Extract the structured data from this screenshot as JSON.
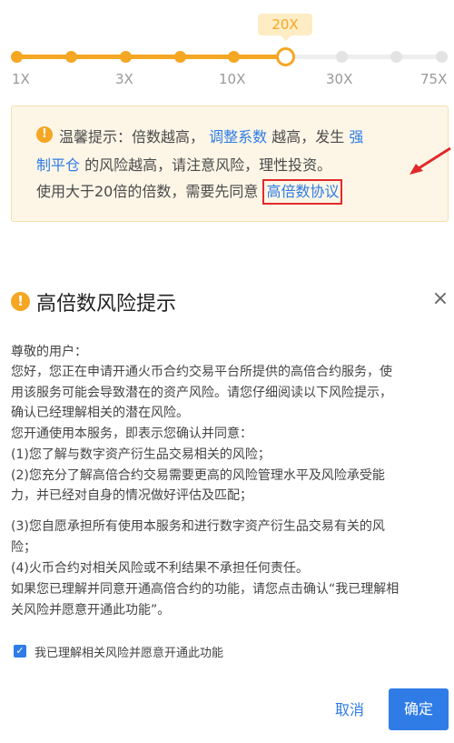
{
  "slider": {
    "current_value": "20X",
    "ticks": [
      "1X",
      "3X",
      "10X",
      "30X",
      "75X"
    ]
  },
  "notice": {
    "line1_a": "温馨提示：倍数越高，",
    "line1_link": "调整系数",
    "line1_b": "越高，发生",
    "line1_link2": "强",
    "line2_link": "制平仓",
    "line2_b": "的风险越高，请注意风险，理性投资。",
    "line3_a": "使用大于20倍的倍数，需要先同意",
    "line3_link": "高倍数协议"
  },
  "modal": {
    "title": "高倍数风险提示",
    "close_symbol": "×",
    "body_lines": [
      "尊敬的用户：",
      "您好，您正在申请开通火币合约交易平台所提供的高倍合约服务，使",
      "用该服务可能会导致潜在的资产风险。请您仔细阅读以下风险提示，",
      "确认已经理解相关的潜在风险。",
      "您开通使用本服务，即表示您确认并同意：",
      "(1)您了解与数字资产衍生品交易相关的风险；",
      "(2)您充分了解高倍合约交易需要更高的风险管理水平及风险承受能",
      "力，并已经对自身的情况做好评估及匹配；",
      "(3)您自愿承担所有使用本服务和进行数字资产衍生品交易有关的风",
      "险；",
      "(4)火币合约对相关风险或不利结果不承担任何责任。",
      "如果您已理解并同意开通高倍合约的功能，请您点击确认“我已理解相",
      "关风险并愿意开通此功能”。"
    ],
    "checkbox_label": "我已理解相关风险并愿意开通此功能",
    "cancel_label": "取消",
    "confirm_label": "确定"
  },
  "colors": {
    "accent": "#f5a623",
    "link": "#2f7ce6",
    "highlight_box": "#e12a2a"
  }
}
